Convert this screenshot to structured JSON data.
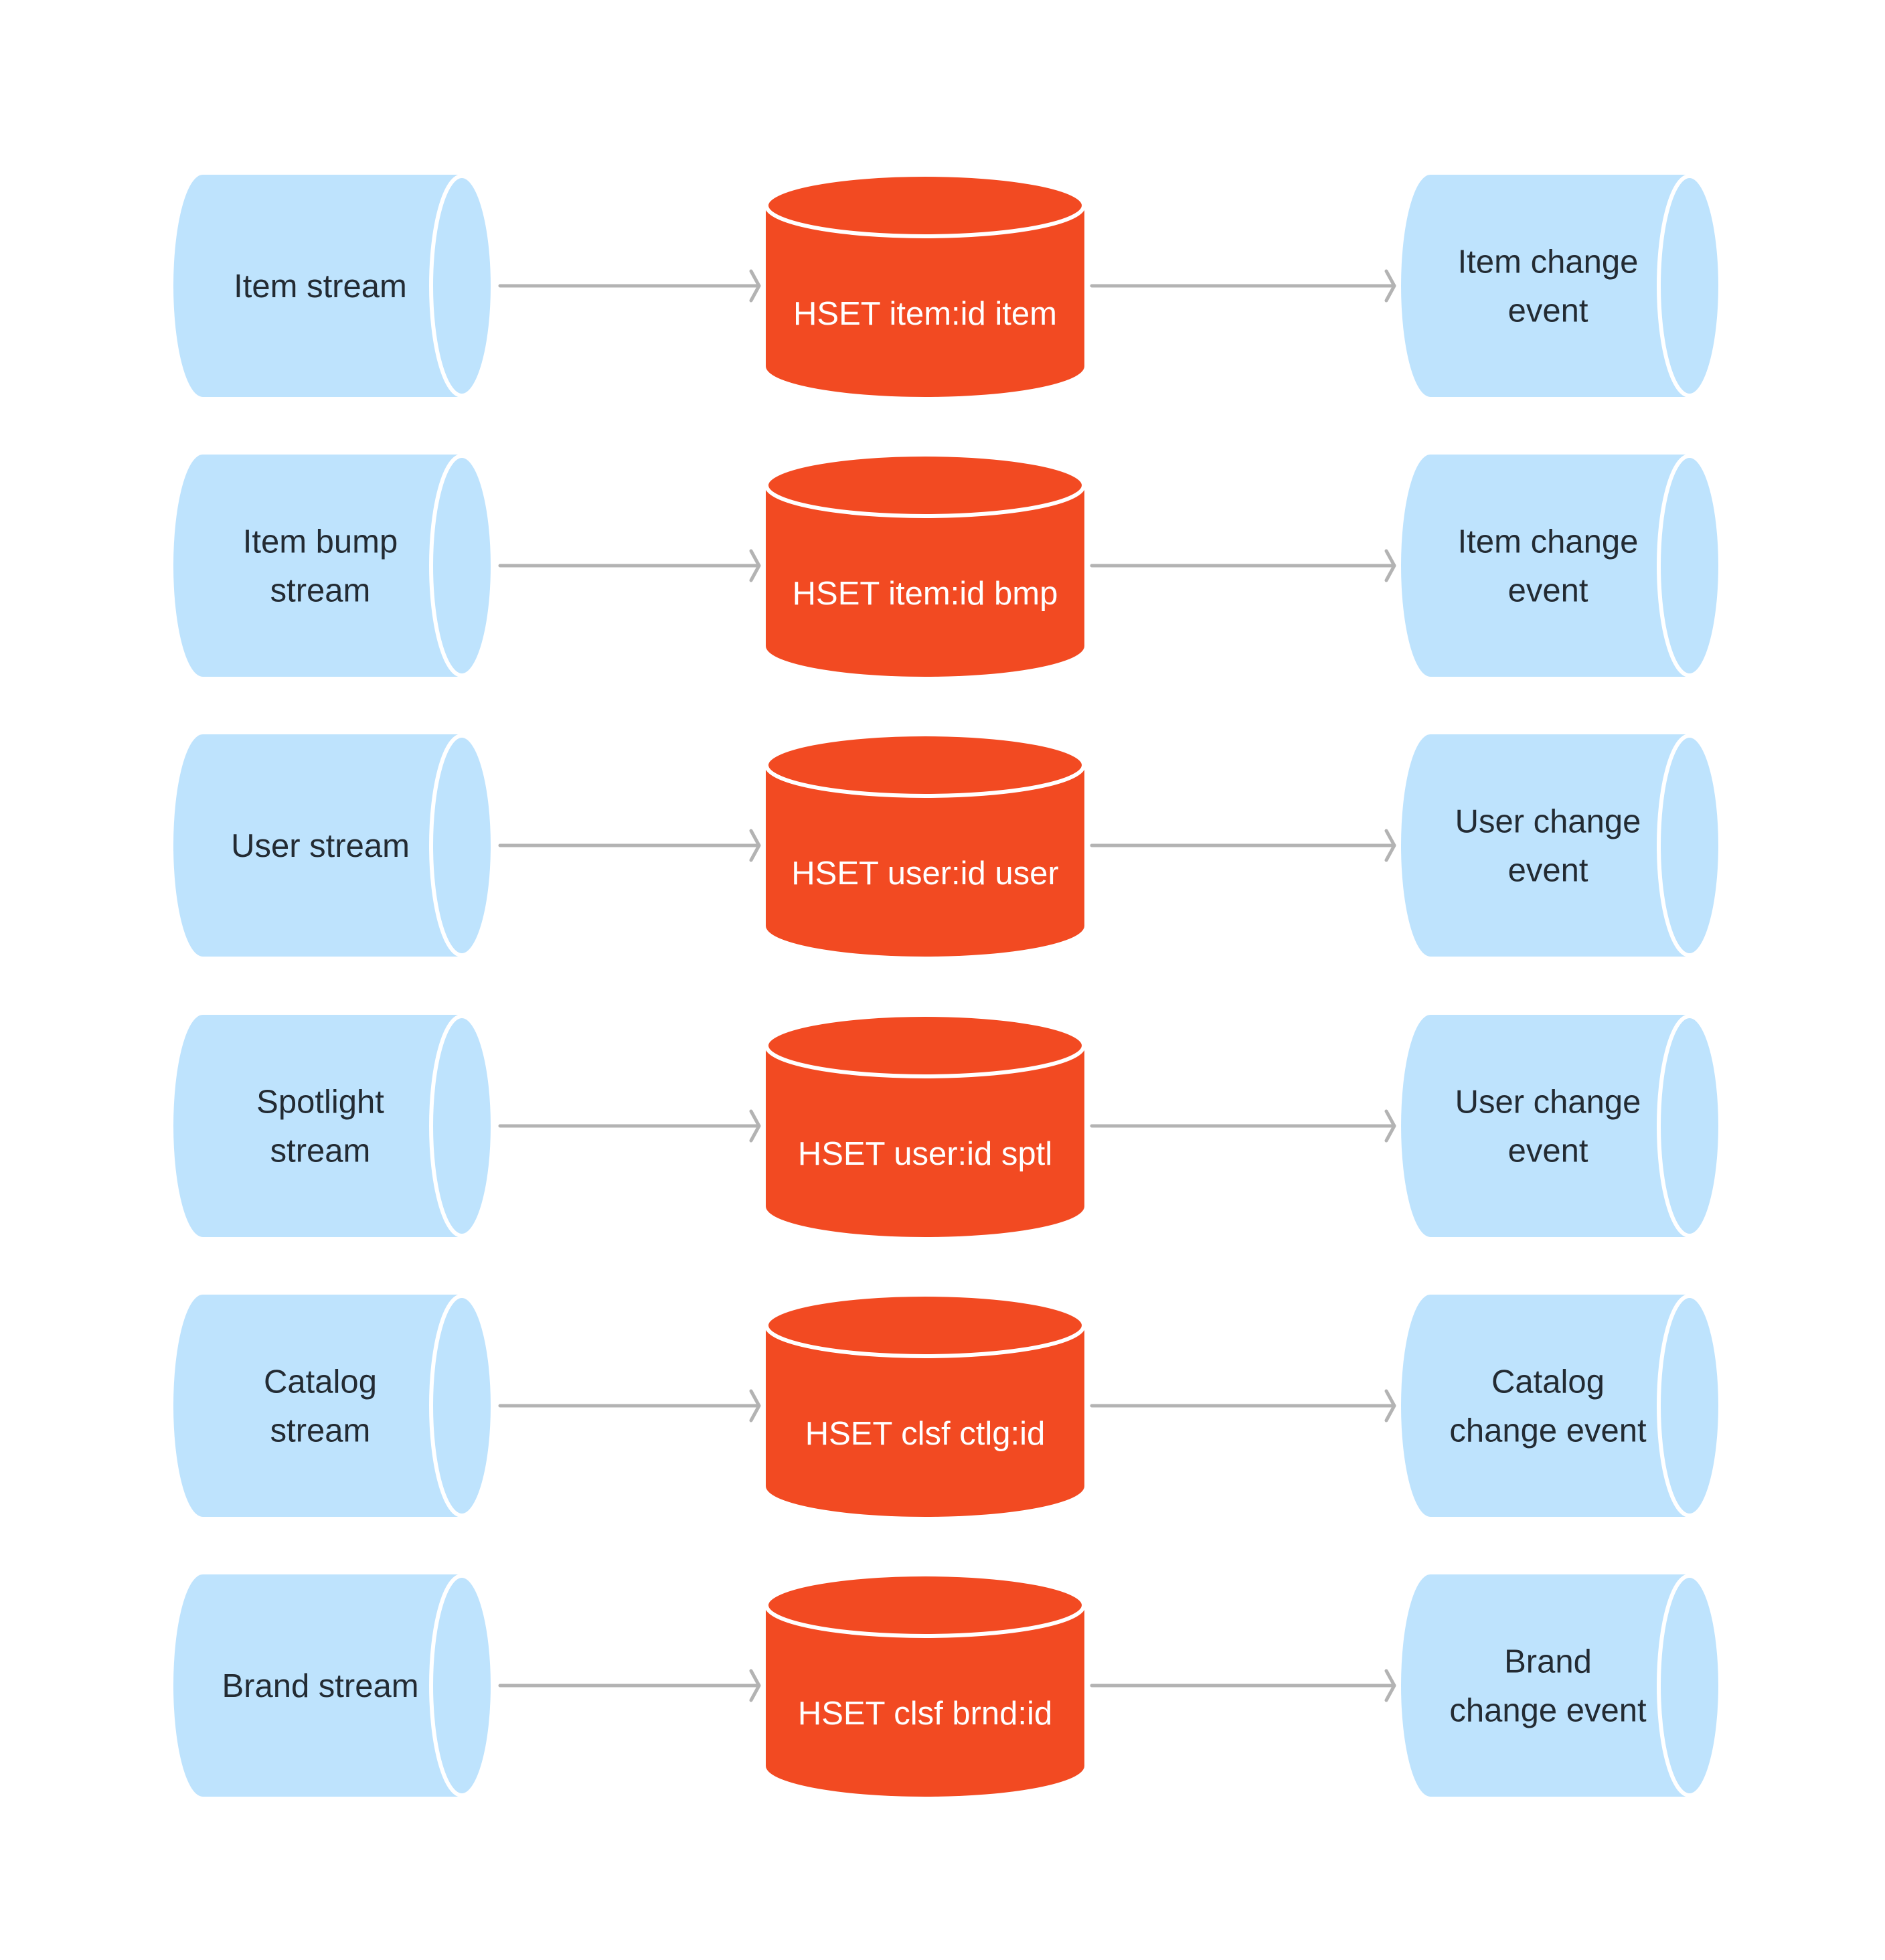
{
  "colors": {
    "stream_fill": "#bee3fd",
    "hset_fill": "#f24a22",
    "arrow": "#b3b3b3",
    "outline": "#ffffff",
    "dark_text": "#232b33",
    "light_text": "#ffffff"
  },
  "rows": [
    {
      "source": [
        "Item stream"
      ],
      "store": "HSET item:id item",
      "event": [
        "Item change",
        "event"
      ]
    },
    {
      "source": [
        "Item bump",
        "stream"
      ],
      "store": "HSET item:id bmp",
      "event": [
        "Item change",
        "event"
      ]
    },
    {
      "source": [
        "User stream"
      ],
      "store": "HSET user:id user",
      "event": [
        "User change",
        "event"
      ]
    },
    {
      "source": [
        "Spotlight",
        "stream"
      ],
      "store": "HSET user:id sptl",
      "event": [
        "User change",
        "event"
      ]
    },
    {
      "source": [
        "Catalog",
        "stream"
      ],
      "store": "HSET clsf ctlg:id",
      "event": [
        "Catalog",
        "change event"
      ]
    },
    {
      "source": [
        "Brand stream"
      ],
      "store": "HSET clsf brnd:id",
      "event": [
        "Brand",
        "change event"
      ]
    }
  ]
}
